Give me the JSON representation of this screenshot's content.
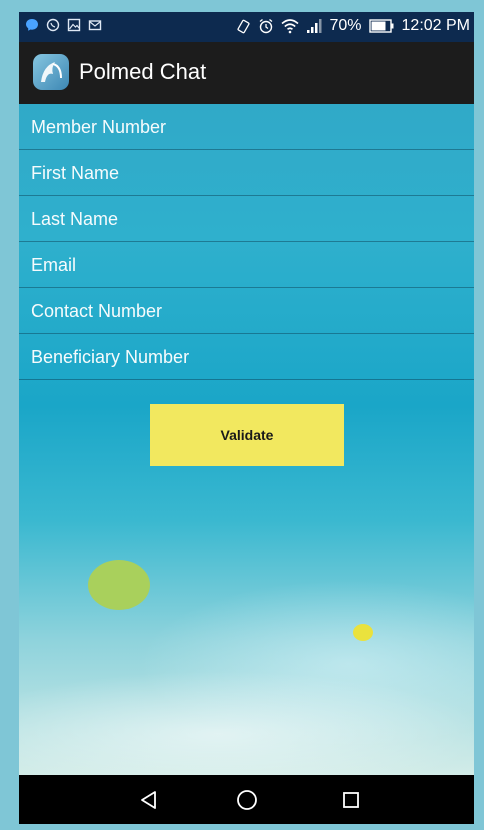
{
  "status_bar": {
    "battery_percent": "70%",
    "time": "12:02 PM",
    "left_icons": [
      "messenger-icon",
      "whatsapp-icon",
      "gallery-icon",
      "mail-icon"
    ],
    "right_icons": [
      "vibrate-icon",
      "alarm-icon",
      "wifi-icon",
      "signal-icon",
      "battery-icon"
    ]
  },
  "app_bar": {
    "title": "Polmed Chat"
  },
  "form": {
    "fields": [
      {
        "placeholder": "Member Number"
      },
      {
        "placeholder": "First Name"
      },
      {
        "placeholder": "Last Name"
      },
      {
        "placeholder": "Email"
      },
      {
        "placeholder": "Contact Number"
      },
      {
        "placeholder": "Beneficiary Number"
      }
    ],
    "submit_label": "Validate"
  },
  "colors": {
    "status_bar": "#0d2a4f",
    "app_bar": "#1c1c1c",
    "button": "#f2e85f",
    "bubble_green": "#a9d05c",
    "bubble_yellow": "#eae23d"
  },
  "nav_bar": {
    "icons": [
      "back-icon",
      "home-icon",
      "recents-icon"
    ]
  }
}
